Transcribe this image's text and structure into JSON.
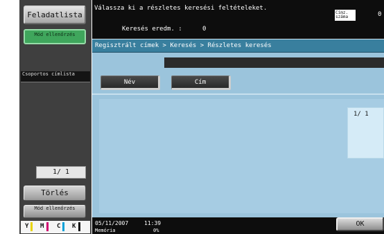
{
  "left_panel": {
    "job_list_label": "Feladatlista",
    "mode_check_label": "Mód ellenőrzés",
    "group_list_label": "Csoportos címlista",
    "page_indicator": "1/ 1",
    "delete_label": "Törlés",
    "mode_check_label_2": "Mód ellenőrzés",
    "toner": [
      {
        "letter": "Y",
        "color": "#e8d400"
      },
      {
        "letter": "M",
        "color": "#d0006f"
      },
      {
        "letter": "C",
        "color": "#00a0d8"
      },
      {
        "letter": "K",
        "color": "#111111"
      }
    ]
  },
  "header": {
    "instruction": "Válassza ki a részletes keresési feltételeket.",
    "result_label": "Keresés eredm.  :",
    "result_count": "0",
    "address_count_label": "Címz. száma",
    "address_count_value": "0"
  },
  "main": {
    "breadcrumb": "Regisztrált címek > Keresés > Részletes keresés",
    "tabs": [
      {
        "label": "Név"
      },
      {
        "label": "Cím"
      }
    ],
    "page_indicator": "1/ 1"
  },
  "footer": {
    "date": "05/11/2007",
    "time": "11:39",
    "memory_label": "Memória",
    "memory_value": "0%",
    "ok_label": "OK"
  }
}
